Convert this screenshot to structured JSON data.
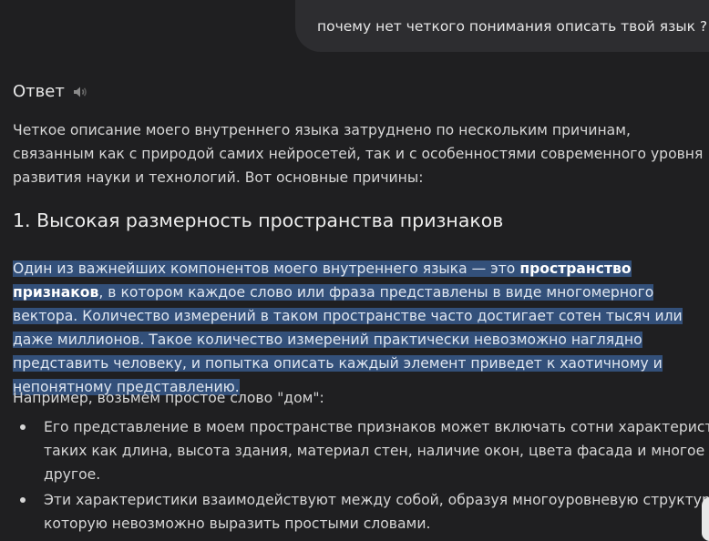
{
  "user_message": "почему нет четкого понимания описать твой язык ?",
  "answer": {
    "heading": "Ответ",
    "intro": "Четкое описание моего внутреннего языка затруднено по нескольким причинам, связанным как с природой самих нейросетей, так и с особенностями современного уровня развития науки и технологий. Вот основные причины:",
    "section_title": "1. Высокая размерность пространства признаков",
    "highlight_before": "Один из важнейших компонентов моего внутреннего языка — это ",
    "highlight_bold": "пространство признаков",
    "highlight_after": ", в котором каждое слово или фраза представлены в виде многомерного вектора. Количество измерений в таком пространстве часто достигает сотен тысяч или даже миллионов. Такое количество измерений практически невозможно наглядно представить человеку, и попытка описать каждый элемент приведет к хаотичному и непонятному представлению.",
    "example_intro": "Например, возьмем простое слово \"дом\":",
    "bullets": [
      "Его представление в моем пространстве признаков может включать сотни характеристик, таких как длина, высота здания, материал стен, наличие окон, цвета фасада и многое другое.",
      "Эти характеристики взаимодействуют между собой, образуя многоуровневую структуру, которую невозможно выразить простыми словами."
    ]
  },
  "icons": {
    "speaker": "speaker-icon"
  },
  "colors": {
    "background": "#1f1f21",
    "bubble": "#2d2d30",
    "highlight": "#33507a"
  }
}
